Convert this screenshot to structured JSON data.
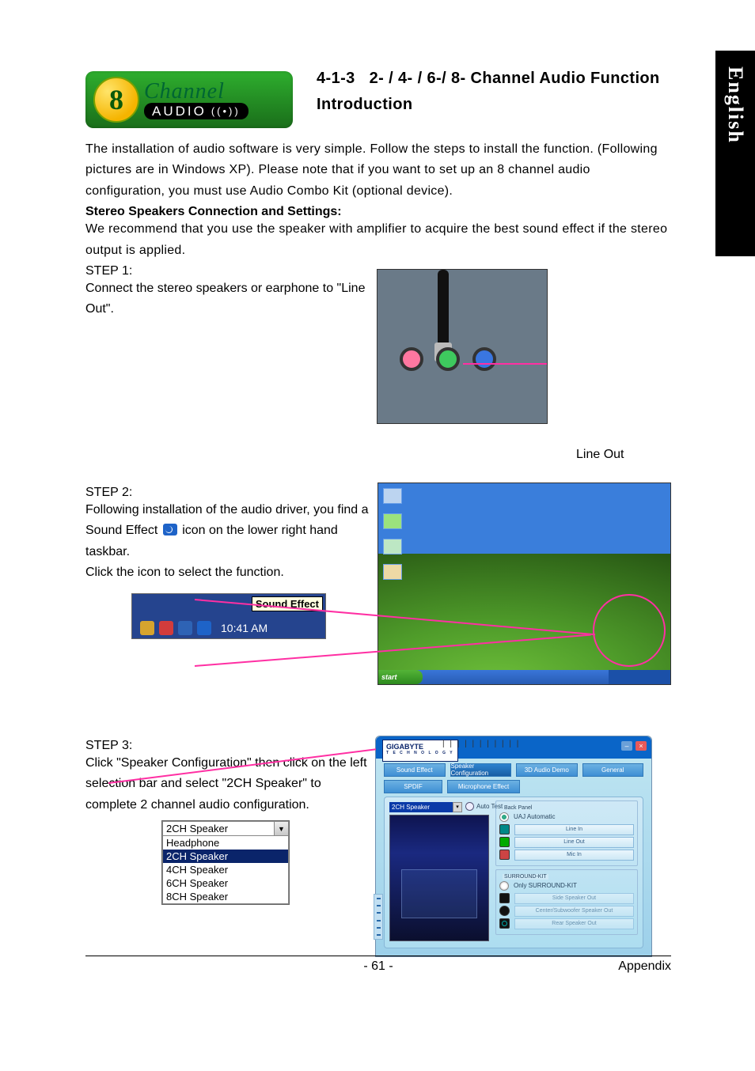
{
  "language_tab": "English",
  "logo": {
    "eight": "8",
    "channel": "Channel",
    "audio": "AUDIO"
  },
  "heading": {
    "number": "4-1-3",
    "title_a": "2- / 4- / 6-/ 8-  Channel Audio Function",
    "title_b": "Introduction"
  },
  "intro": "The installation of audio software is very simple. Follow the steps to install the function. (Following pictures are in Windows XP). Please note that if you want to set up an 8 channel audio configuration, you must use Audio Combo Kit (optional device).",
  "subheading": "Stereo Speakers Connection and Settings:",
  "stereo_recommend": "We recommend that you use the speaker with amplifier to acquire the best sound effect if the stereo output is applied.",
  "step1": {
    "label": "STEP 1:",
    "text": "Connect the stereo speakers or earphone to \"Line Out\".",
    "callout": "Line Out"
  },
  "step2": {
    "label": "STEP 2:",
    "line1": "Following installation of the audio driver, you find a",
    "line2a": "Sound Effect ",
    "line2b": " icon on the lower right hand taskbar.",
    "line3": "Click the icon to select the function.",
    "tooltip": "Sound Effect",
    "clock_time": "10:41 AM",
    "desktop_start": "start"
  },
  "step3": {
    "label": "STEP 3:",
    "text": "Click \"Speaker Configuration\" then click on the left selection bar and select \"2CH Speaker\" to complete 2 channel audio configuration.",
    "dropdown": {
      "value": "2CH Speaker",
      "options": [
        "Headphone",
        "2CH Speaker",
        "4CH Speaker",
        "6CH Speaker",
        "8CH Speaker"
      ],
      "selected_index": 1
    },
    "config": {
      "brand": "GIGABYTE",
      "brand_sub": "T E C H N O L O G Y",
      "titlebar_grip": "| | | | | | | | | | |",
      "tabs_row1": [
        "Sound Effect",
        "Speaker Configuration",
        "3D Audio Demo",
        "General"
      ],
      "tabs_row2": [
        "SPDIF",
        "Microphone Effect"
      ],
      "selected_tab": "Speaker Configuration",
      "select_value": "2CH Speaker",
      "auto_test": "Auto Test",
      "back_panel_legend": "Back Panel",
      "uaj_label": "UAJ Automatic",
      "ports": [
        "Line In",
        "Line Out",
        "Mic In"
      ],
      "surround_legend": "SURROUND-KIT",
      "surround_option": "Only SURROUND-KIT",
      "surround_ports": [
        "Side Speaker Out",
        "Center/Subwoofer Speaker Out",
        "Rear Speaker Out"
      ]
    }
  },
  "footer": {
    "page": "- 61 -",
    "section": "Appendix"
  }
}
